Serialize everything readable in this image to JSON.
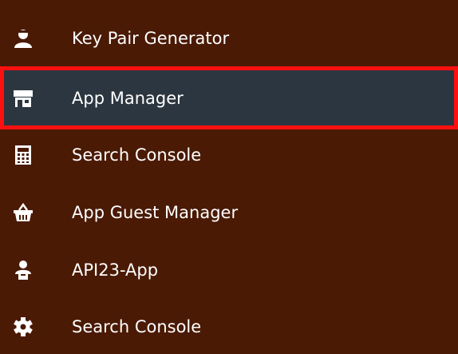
{
  "menu": {
    "items": [
      {
        "label": "Key Pair Generator",
        "icon": "user-key-icon"
      },
      {
        "label": "App Manager",
        "icon": "store-icon",
        "active": true
      },
      {
        "label": "Search Console",
        "icon": "calculator-icon"
      },
      {
        "label": "App Guest Manager",
        "icon": "basket-icon"
      },
      {
        "label": "API23-App",
        "icon": "user-box-icon"
      },
      {
        "label": "Search Console",
        "icon": "gear-icon"
      }
    ]
  },
  "colors": {
    "background": "#4a1a05",
    "active_background": "#2b3640",
    "active_border": "#ff1010",
    "text": "#ffffff"
  }
}
